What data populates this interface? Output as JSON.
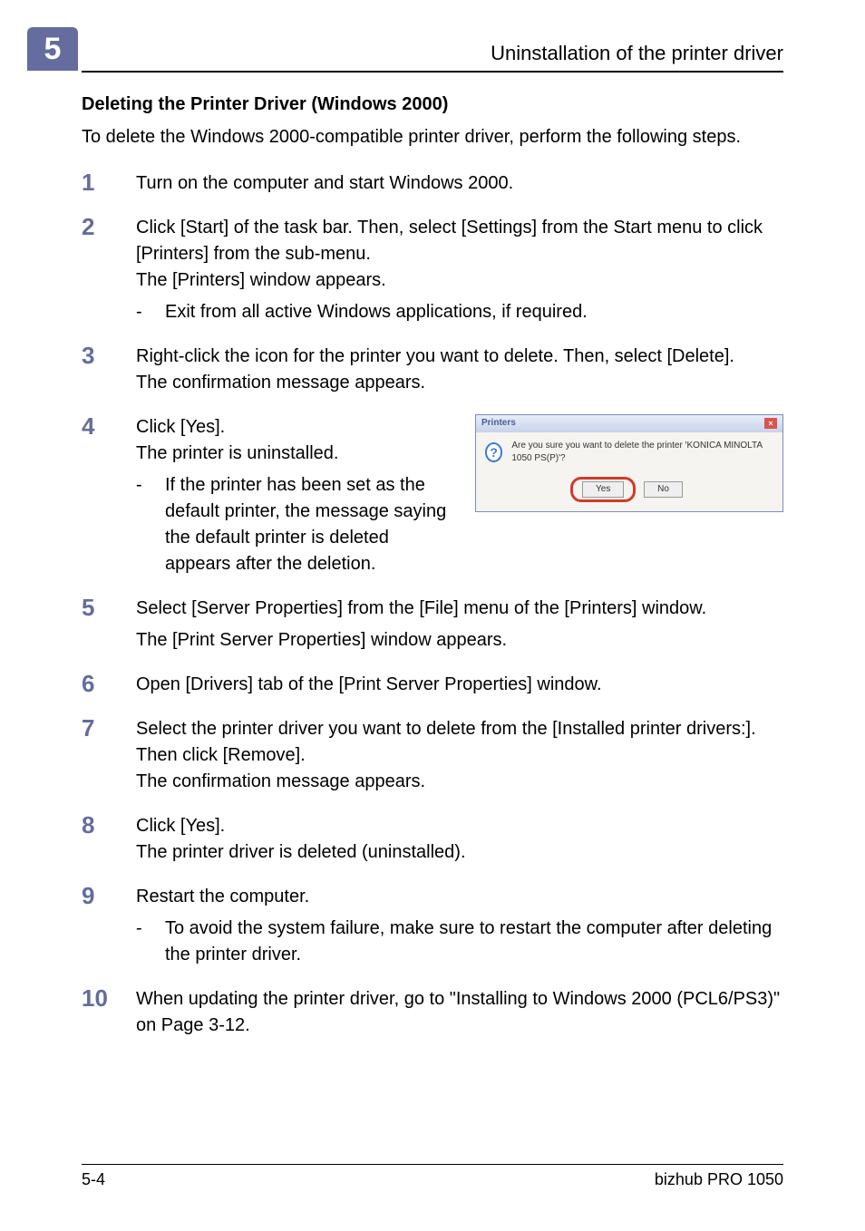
{
  "header": {
    "chapter_number": "5",
    "title": "Uninstallation of the printer driver"
  },
  "section_title": "Deleting the Printer Driver (Windows 2000)",
  "intro": "To delete the Windows 2000-compatible printer driver, perform the following steps.",
  "steps": {
    "s1": {
      "num": "1",
      "text": "Turn on the computer and start Windows 2000."
    },
    "s2": {
      "num": "2",
      "line1": "Click [Start] of the task bar. Then, select [Settings] from the Start menu to click [Printers] from the sub-menu.",
      "line2": "The [Printers] window appears.",
      "sub": "Exit from all active Windows applications, if required."
    },
    "s3": {
      "num": "3",
      "line1": "Right-click the icon for the printer you want to delete. Then, select [Delete].",
      "line2": "The confirmation message appears."
    },
    "s4": {
      "num": "4",
      "line1": "Click [Yes].",
      "line2": "The printer is uninstalled.",
      "sub": "If the printer has been set as the default printer, the message saying the default printer is deleted appears after the deletion."
    },
    "s5": {
      "num": "5",
      "line1": "Select [Server Properties] from the [File] menu of the [Printers] window.",
      "line2": "The [Print Server Properties] window appears."
    },
    "s6": {
      "num": "6",
      "text": "Open [Drivers] tab of the [Print Server Properties] window."
    },
    "s7": {
      "num": "7",
      "line1": "Select the printer driver you want to delete from the [Installed printer drivers:]. Then click [Remove].",
      "line2": "The confirmation message appears."
    },
    "s8": {
      "num": "8",
      "line1": "Click [Yes].",
      "line2": "The printer driver is deleted (uninstalled)."
    },
    "s9": {
      "num": "9",
      "line1": "Restart the computer.",
      "sub": "To avoid the system failure, make sure to restart the computer after deleting the printer driver."
    },
    "s10": {
      "num": "10",
      "text": "When updating the printer driver, go to \"Installing to Windows 2000 (PCL6/PS3)\" on Page 3-12."
    }
  },
  "dialog": {
    "title": "Printers",
    "message": "Are you sure you want to delete the printer 'KONICA MINOLTA 1050 PS(P)'?",
    "yes": "Yes",
    "no": "No",
    "close": "×",
    "qmark": "?"
  },
  "footer": {
    "page": "5-4",
    "product": "bizhub PRO 1050"
  },
  "dash": "-"
}
